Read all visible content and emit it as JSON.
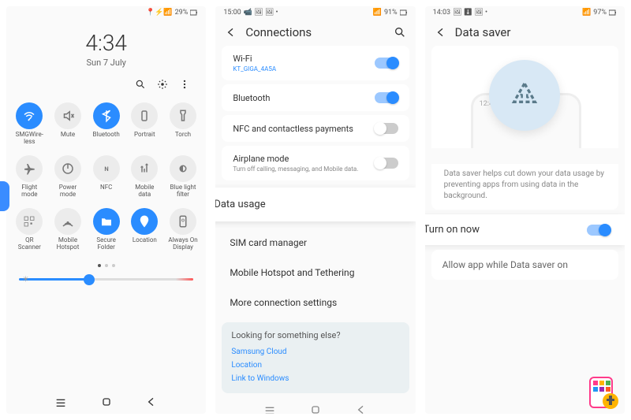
{
  "screen1": {
    "status": {
      "battery": "29%",
      "icons": "📍⚡📶"
    },
    "clock": {
      "time": "4:34",
      "date": "Sun 7 July"
    },
    "tiles": [
      {
        "label": "SMGWire-\nless",
        "icon": "wifi",
        "active": true
      },
      {
        "label": "Mute",
        "icon": "mute",
        "active": false
      },
      {
        "label": "Bluetooth",
        "icon": "bt",
        "active": true
      },
      {
        "label": "Portrait",
        "icon": "rotate",
        "active": false
      },
      {
        "label": "Torch",
        "icon": "torch",
        "active": false
      },
      {
        "label": "Flight\nmode",
        "icon": "plane",
        "active": false
      },
      {
        "label": "Power\nmode",
        "icon": "power",
        "active": false
      },
      {
        "label": "NFC",
        "icon": "nfc",
        "active": false
      },
      {
        "label": "Mobile\ndata",
        "icon": "mdata",
        "active": false
      },
      {
        "label": "Blue light\nfilter",
        "icon": "blf",
        "active": false
      },
      {
        "label": "QR\nScanner",
        "icon": "qr",
        "active": false
      },
      {
        "label": "Mobile\nHotspot",
        "icon": "hot",
        "active": false
      },
      {
        "label": "Secure\nFolder",
        "icon": "folder",
        "active": true
      },
      {
        "label": "Location",
        "icon": "loc",
        "active": true
      },
      {
        "label": "Always On\nDisplay",
        "icon": "aod",
        "active": false
      }
    ]
  },
  "screen2": {
    "status": {
      "time": "15:00",
      "battery": "91%",
      "icons": "📹🖼🖼 •"
    },
    "title": "Connections",
    "wifi": {
      "label": "Wi-Fi",
      "value": "KT_GIGA_4A5A",
      "on": true
    },
    "bt": {
      "label": "Bluetooth",
      "on": true
    },
    "nfc": {
      "label": "NFC and contactless payments",
      "on": false
    },
    "airplane": {
      "label": "Airplane mode",
      "sub": "Turn off calling, messaging, and Mobile data.",
      "on": false
    },
    "datausage": "Data usage",
    "items": [
      "SIM card manager",
      "Mobile Hotspot and Tethering",
      "More connection settings"
    ],
    "footer": {
      "q": "Looking for something else?",
      "links": [
        "Samsung Cloud",
        "Location",
        "Link to Windows"
      ]
    }
  },
  "screen3": {
    "status": {
      "time": "14:03",
      "battery": "97%",
      "icons": "🖼⬇🖼 •"
    },
    "title": "Data saver",
    "illus_time": "12:45",
    "desc": "Data saver helps cut down your data usage by preventing apps from using data in the background.",
    "turn": {
      "label": "Turn on now",
      "on": true
    },
    "allow": "Allow app while Data saver on"
  }
}
